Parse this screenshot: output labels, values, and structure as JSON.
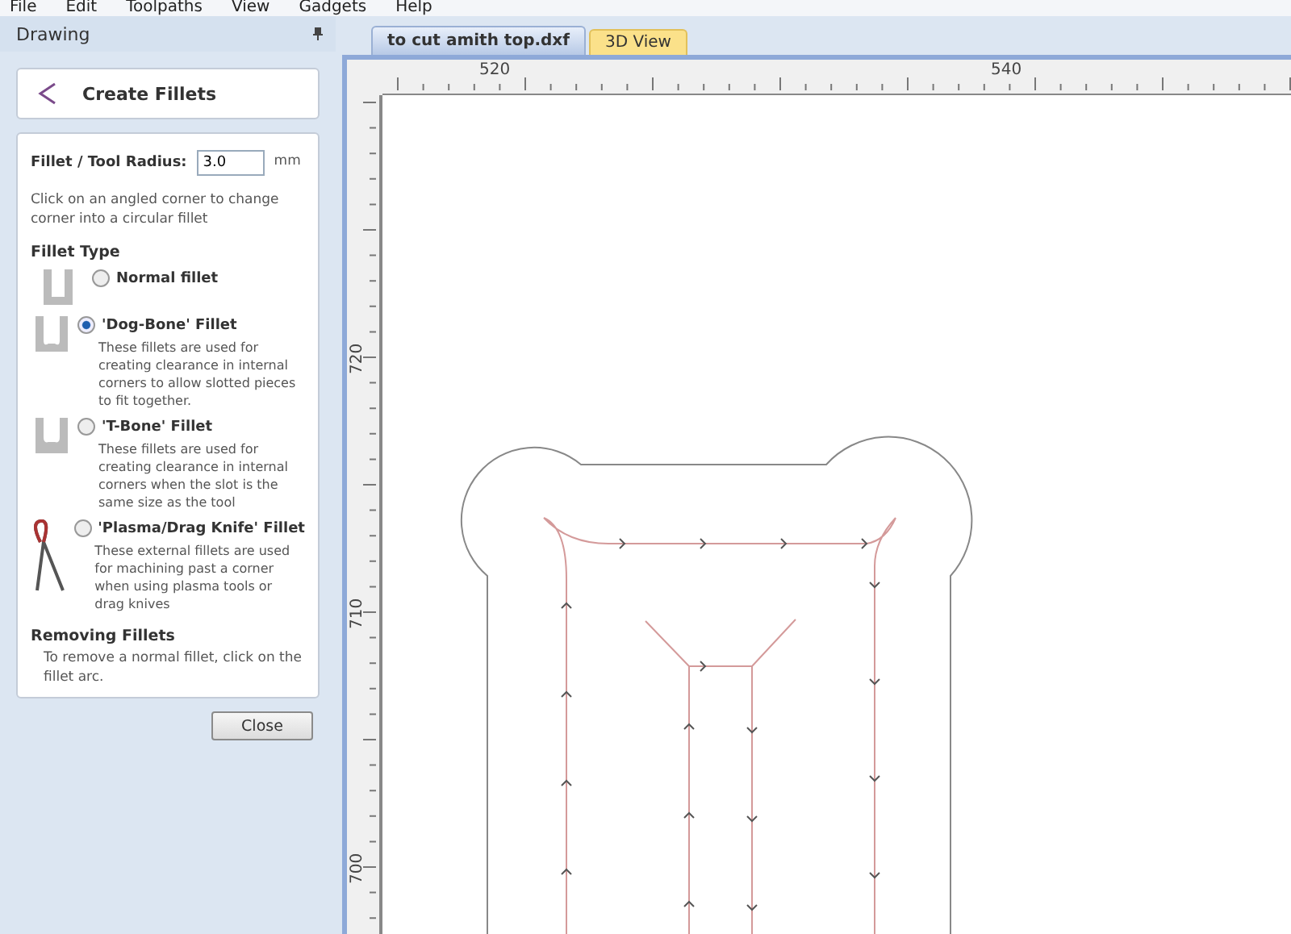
{
  "menu": [
    "File",
    "Edit",
    "Toolpaths",
    "View",
    "Gadgets",
    "Help"
  ],
  "panel": {
    "title": "Drawing",
    "tool_title": "Create Fillets",
    "radius_label": "Fillet / Tool Radius:",
    "radius_value": "3.0",
    "radius_unit": "mm",
    "instruction": "Click on an angled corner to change corner into a circular fillet",
    "type_heading": "Fillet Type",
    "fillet_types": [
      {
        "kind": "normal",
        "label": "Normal fillet",
        "selected": false
      },
      {
        "kind": "dogbone",
        "label": "'Dog-Bone' Fillet",
        "selected": true,
        "description": "These fillets are used for creating clearance in internal corners to allow slotted pieces to fit together."
      },
      {
        "kind": "tbone",
        "label": "'T-Bone' Fillet",
        "selected": false,
        "description": "These fillets are used for creating clearance in internal corners when the slot is the same size as the tool"
      },
      {
        "kind": "plasma",
        "label": "'Plasma/Drag Knife' Fillet",
        "selected": false,
        "description": "These external fillets are used for machining past a corner when using plasma tools or drag knives"
      }
    ],
    "removing_heading": "Removing Fillets",
    "removing_text": "To remove a normal fillet, click on the fillet arc.",
    "close_button": "Close"
  },
  "tabs": [
    {
      "label": "to cut amith top.dxf",
      "selected": true
    },
    {
      "label": "3D View",
      "selected": false
    }
  ],
  "ruler": {
    "top_labels": [
      "520",
      "540"
    ],
    "left_labels": [
      "720",
      "710",
      "700"
    ]
  }
}
